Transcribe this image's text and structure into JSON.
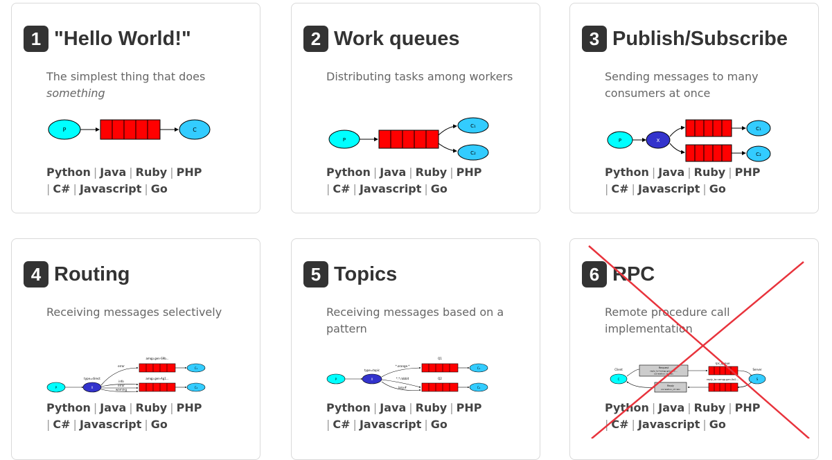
{
  "tutorials": [
    {
      "number": "1",
      "title": "\"Hello World!\"",
      "desc_main": "The simplest thing that does",
      "desc_em": "something",
      "diagram": {
        "labels": [
          "P",
          "C"
        ]
      }
    },
    {
      "number": "2",
      "title": "Work queues",
      "desc_main": "Distributing tasks among workers",
      "diagram": {
        "labels": [
          "P",
          "C₁",
          "C₂"
        ]
      }
    },
    {
      "number": "3",
      "title": "Publish/Subscribe",
      "desc_main": "Sending messages to many consumers at once",
      "diagram": {
        "labels": [
          "P",
          "X",
          "C₁",
          "C₂"
        ]
      }
    },
    {
      "number": "4",
      "title": "Routing",
      "desc_main": "Receiving messages selectively",
      "diagram": {
        "labels": [
          "P",
          "X",
          "type=direct",
          "error",
          "info",
          "error",
          "warning",
          "amqp.gen-S9b...",
          "amqp.gen-Ag1...",
          "C₁",
          "C₂"
        ]
      }
    },
    {
      "number": "5",
      "title": "Topics",
      "desc_main": "Receiving messages based on a pattern",
      "diagram": {
        "labels": [
          "P",
          "X",
          "type=topic",
          "*.orange.*",
          "*.*.rabbit",
          "lazy.#",
          "Q1",
          "Q2",
          "C₁",
          "C₂"
        ]
      }
    },
    {
      "number": "6",
      "title": "RPC",
      "desc_main": "Remote procedure call implementation",
      "crossed_out": true,
      "diagram": {
        "labels": [
          "Client",
          "C",
          "Request",
          "reply_to=amqp.gen-Xa2...",
          "correlation_id=abc",
          "rpc_queue",
          "Reply",
          "correlation_id=abc",
          "reply_to=amqp.gen-Xa2...",
          "Server",
          "S"
        ]
      }
    }
  ],
  "languages": [
    "Python",
    "Java",
    "Ruby",
    "PHP",
    "C#",
    "Javascript",
    "Go"
  ],
  "colors": {
    "queue": "#ff0000",
    "producer": "#00ffff",
    "consumer": "#33ccff",
    "exchange": "#3333cc",
    "cross": "#e8333c",
    "badge": "#333333"
  }
}
